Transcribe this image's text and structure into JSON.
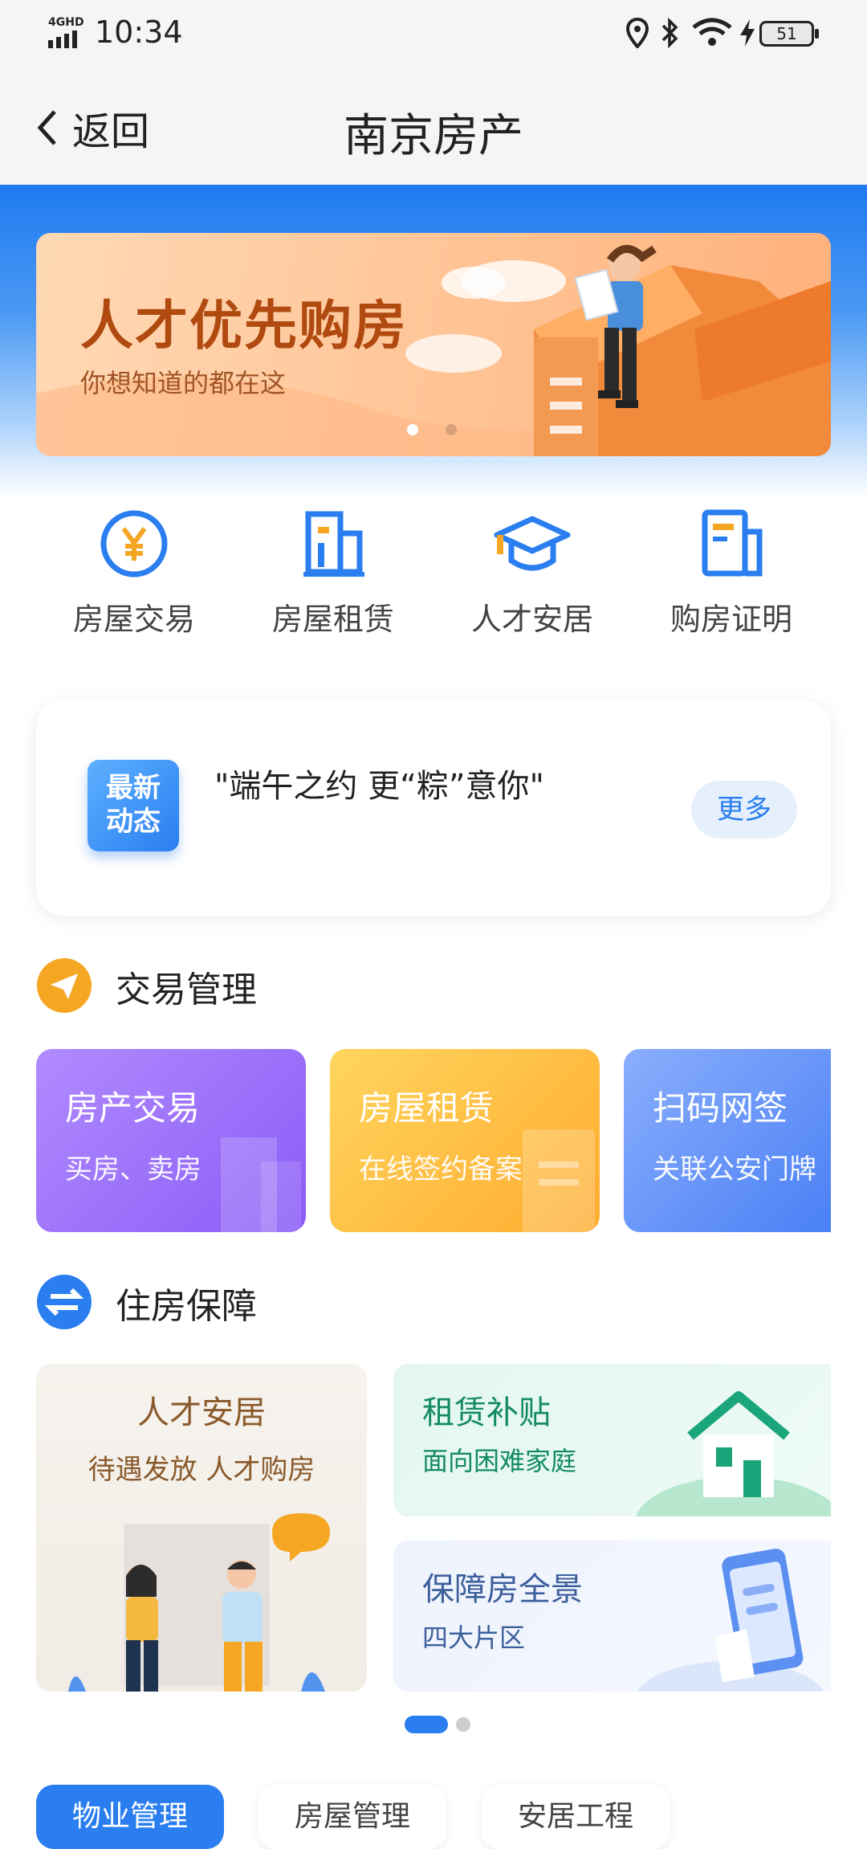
{
  "status_bar": {
    "network": "4GHD",
    "time": "10:34",
    "battery": "51"
  },
  "nav": {
    "back_label": "返回",
    "title": "南京房产"
  },
  "banner": {
    "title": "人才优先购房",
    "subtitle": "你想知道的都在这"
  },
  "quick_icons": [
    {
      "label": "房屋交易",
      "icon": "yen-coin-icon"
    },
    {
      "label": "房屋租赁",
      "icon": "building-icon"
    },
    {
      "label": "人才安居",
      "icon": "graduation-cap-icon"
    },
    {
      "label": "购房证明",
      "icon": "document-icon"
    }
  ],
  "news": {
    "badge_line1": "最新",
    "badge_line2": "动态",
    "headline": "\"端午之约 更“粽”意你\"",
    "more_label": "更多"
  },
  "trade": {
    "title": "交易管理",
    "cards": [
      {
        "title": "房产交易",
        "subtitle": "买房、卖房"
      },
      {
        "title": "房屋租赁",
        "subtitle": "在线签约备案"
      },
      {
        "title": "扫码网签",
        "subtitle": "关联公安门牌"
      }
    ]
  },
  "housing": {
    "title": "住房保障",
    "talent": {
      "title": "人才安居",
      "subtitle": "待遇发放 人才购房"
    },
    "rent": {
      "title": "租赁补贴",
      "subtitle": "面向困难家庭"
    },
    "panorama": {
      "title": "保障房全景",
      "subtitle": "四大片区"
    }
  },
  "bottom_tabs": [
    "物业管理",
    "房屋管理",
    "安居工程"
  ],
  "colors": {
    "primary": "#2a7ef0",
    "orange": "#f5a623",
    "green": "#1aa57a"
  }
}
